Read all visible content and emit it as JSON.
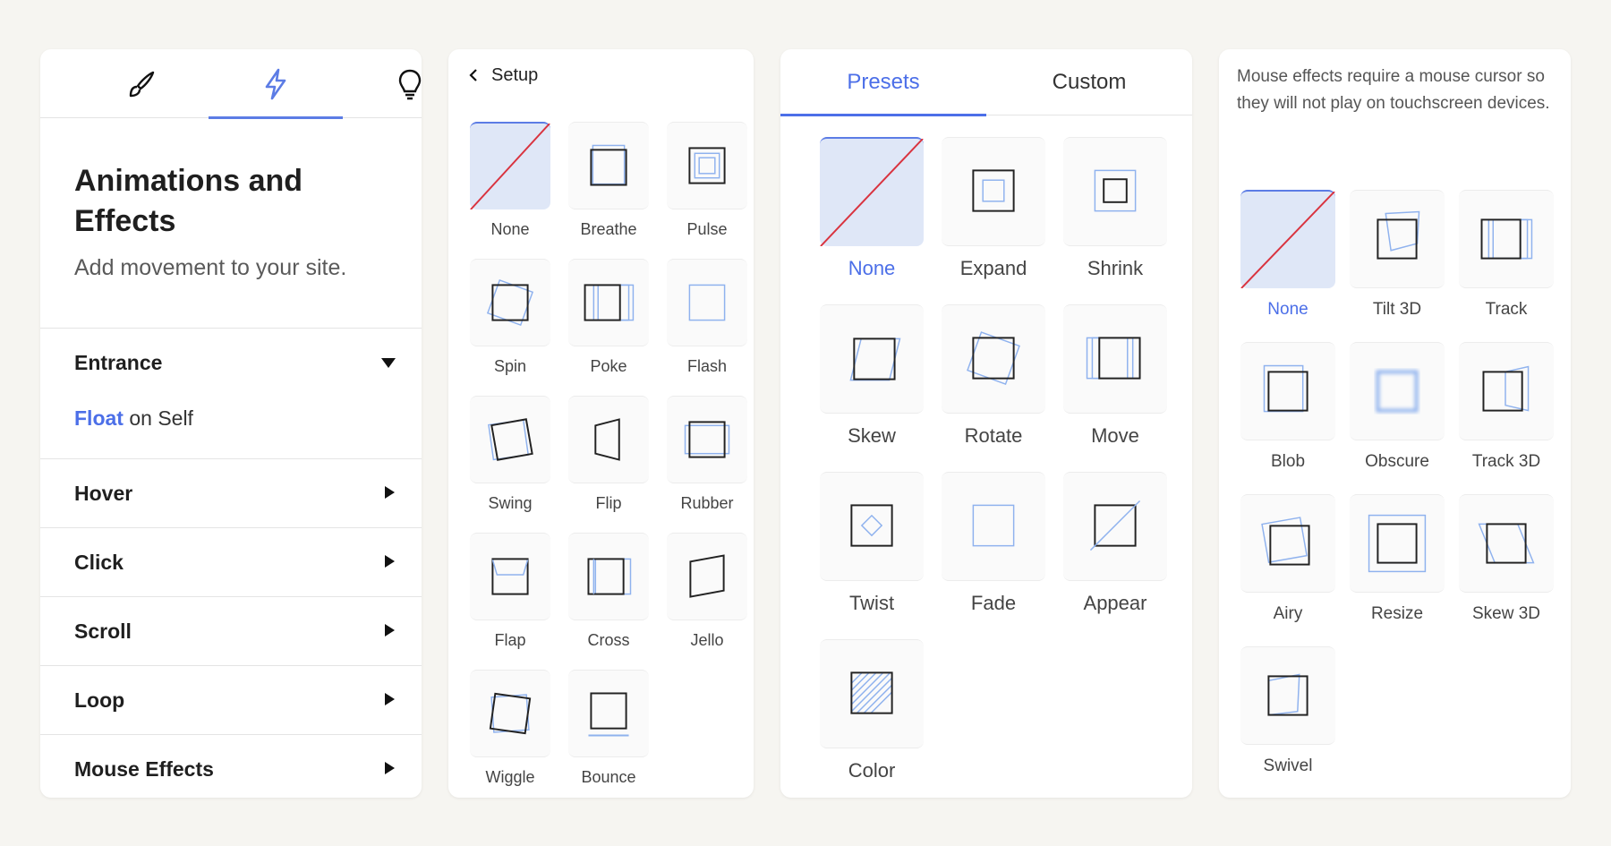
{
  "panel1": {
    "tabs": [
      {
        "icon": "brush-icon"
      },
      {
        "icon": "lightning-icon",
        "active": true
      },
      {
        "icon": "lightbulb-icon"
      }
    ],
    "title_line1": "Animations and",
    "title_line2": "Effects",
    "subtitle": "Add movement to your site.",
    "entrance": {
      "title": "Entrance",
      "value_highlight": "Float",
      "value_rest": " on Self"
    },
    "sections": [
      "Hover",
      "Click",
      "Scroll",
      "Loop",
      "Mouse Effects"
    ],
    "accent": "#4c6fe8"
  },
  "panel2": {
    "back_label": "Setup",
    "items": [
      "None",
      "Breathe",
      "Pulse",
      "Spin",
      "Poke",
      "Flash",
      "Swing",
      "Flip",
      "Rubber",
      "Flap",
      "Cross",
      "Jello",
      "Wiggle",
      "Bounce"
    ]
  },
  "panel3": {
    "tabs": [
      "Presets",
      "Custom"
    ],
    "items": [
      "None",
      "Expand",
      "Shrink",
      "Skew",
      "Rotate",
      "Move",
      "Twist",
      "Fade",
      "Appear",
      "Color"
    ]
  },
  "panel4": {
    "note": "Mouse effects require a mouse cursor so they will not play on touchscreen devices.",
    "items": [
      "None",
      "Tilt 3D",
      "Track",
      "Blob",
      "Obscure",
      "Track 3D",
      "Airy",
      "Resize",
      "Skew 3D",
      "Swivel"
    ]
  }
}
